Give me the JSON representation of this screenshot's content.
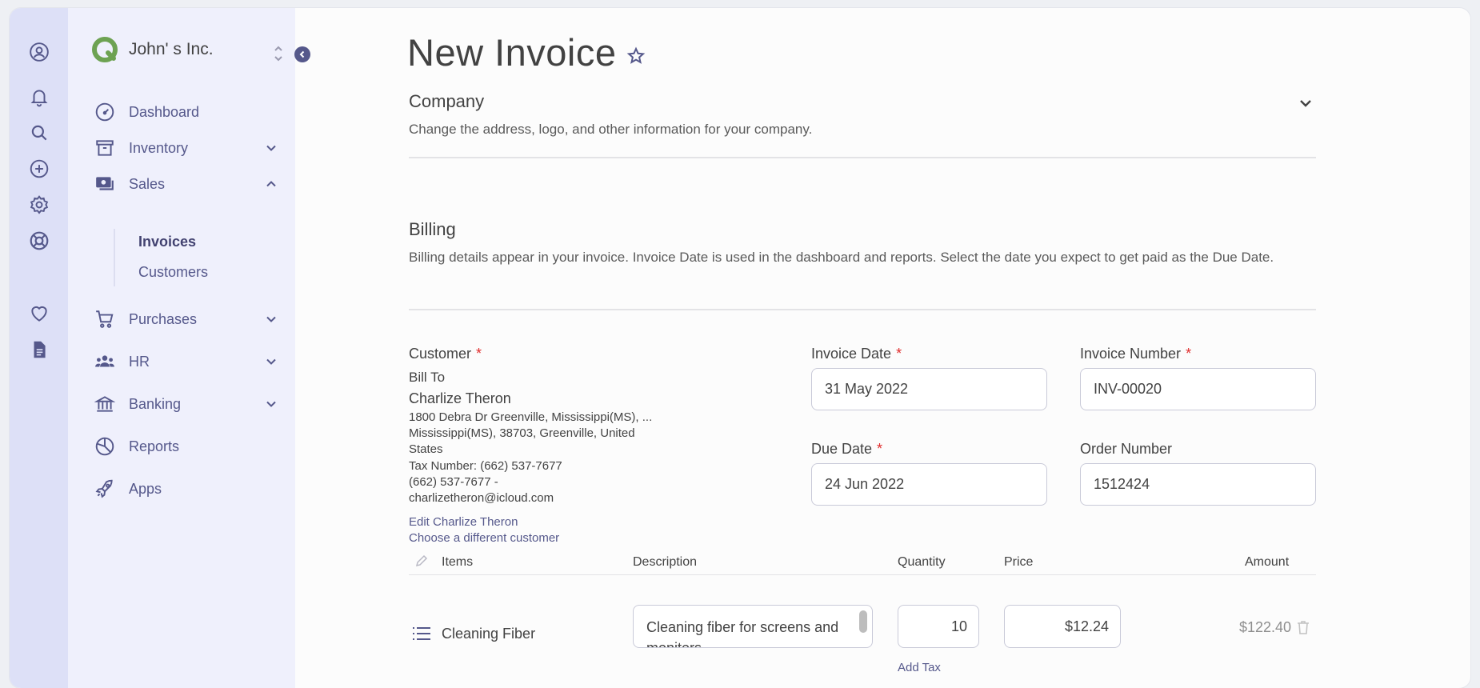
{
  "company": {
    "name": "John' s Inc."
  },
  "nav": {
    "dashboard": "Dashboard",
    "inventory": "Inventory",
    "sales": "Sales",
    "invoices": "Invoices",
    "customers": "Customers",
    "purchases": "Purchases",
    "hr": "HR",
    "banking": "Banking",
    "reports": "Reports",
    "apps": "Apps"
  },
  "page": {
    "title": "New Invoice"
  },
  "sections": {
    "company_title": "Company",
    "company_desc": "Change the address, logo, and other information for your company.",
    "billing_title": "Billing",
    "billing_desc": "Billing details appear in your invoice. Invoice Date is used in the dashboard and reports. Select the date you expect to get paid as the Due Date."
  },
  "customer": {
    "label": "Customer",
    "bill_to": "Bill To",
    "name": "Charlize Theron",
    "address_1": "1800 Debra Dr Greenville, Mississippi(MS),  ...",
    "address_2": "Mississippi(MS), 38703, Greenville, United",
    "address_3": "States",
    "tax_number": "Tax Number: (662) 537-7677",
    "phone": "(662) 537-7677   -",
    "email": "charlizetheron@icloud.com",
    "edit_link": "Edit Charlize Theron",
    "choose_link": "Choose a different customer"
  },
  "fields": {
    "invoice_date_label": "Invoice Date",
    "invoice_date": "31 May 2022",
    "invoice_number_label": "Invoice Number",
    "invoice_number": "INV-00020",
    "due_date_label": "Due Date",
    "due_date": "24 Jun 2022",
    "order_number_label": "Order Number",
    "order_number": "1512424",
    "required_mark": "*"
  },
  "items_table": {
    "headers": {
      "items": "Items",
      "description": "Description",
      "quantity": "Quantity",
      "price": "Price",
      "amount": "Amount"
    },
    "rows": [
      {
        "item": "Cleaning Fiber",
        "description": "Cleaning fiber for screens and monitors",
        "quantity": "10",
        "price": "$12.24",
        "amount": "$122.40"
      }
    ],
    "add_tax": "Add Tax"
  },
  "colors": {
    "accent": "#55588b",
    "rail_bg": "#dde0f7",
    "sidebar_bg": "#eff0fc",
    "required": "#e02b2b",
    "logo_green": "#6da252"
  }
}
